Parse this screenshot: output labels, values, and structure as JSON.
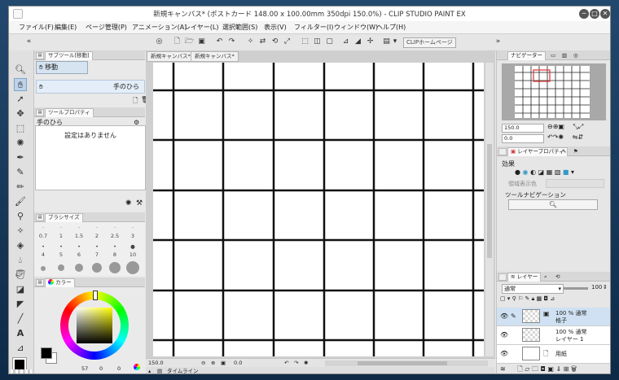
{
  "window": {
    "title": "新規キャンバス* (ポストカード 148.00 x 100.00mm 350dpi 150.0%) - CLIP STUDIO PAINT EX",
    "controls": [
      "─",
      "□",
      "✕"
    ]
  },
  "menu": [
    "ファイル(F)",
    "編集(E)",
    "ページ管理(P)",
    "アニメーション(A)",
    "レイヤー(L)",
    "選択範囲(S)",
    "表示(V)",
    "フィルター(I)",
    "ウィンドウ(W)",
    "ヘルプ(H)"
  ],
  "toolbar": {
    "home_button": "CLIPホームページ"
  },
  "subtool_panel": {
    "tab": "サブツール[移動]",
    "group": "移動",
    "selected": "手のひら"
  },
  "tool_property": {
    "tab": "ツールプロパティ",
    "tool_name": "手のひら",
    "empty_message": "設定はありません"
  },
  "brush_size": {
    "tab": "ブラシサイズ",
    "sizes": [
      "0.7",
      "1",
      "1.5",
      "2",
      "2.5",
      "3",
      "4",
      "5",
      "6",
      "7",
      "8",
      "10"
    ]
  },
  "color": {
    "tab": "カラー",
    "main": "#000000",
    "sub": "#ffffff",
    "values": [
      "57",
      "0",
      "0"
    ]
  },
  "canvas": {
    "tabs": [
      "新規キャンバス*",
      "新規キャンバス*"
    ],
    "zoom": "150.0",
    "rotation": "0.0",
    "timeline": "タイムライン"
  },
  "navigator": {
    "tab": "ナビゲーター",
    "zoom": "150.0",
    "rotation": "0.0"
  },
  "layer_property": {
    "tab": "レイヤープロパティ",
    "effect_label": "効果",
    "area_color": "領域表示色",
    "tool_nav": "ツールナビゲーション"
  },
  "layers": {
    "tab": "レイヤー",
    "blend": "通常",
    "opacity": "100",
    "items": [
      {
        "mode": "100 % 通常",
        "name": "格子"
      },
      {
        "mode": "100 % 通常",
        "name": "レイヤー 1"
      },
      {
        "mode": "",
        "name": "用紙"
      }
    ]
  }
}
